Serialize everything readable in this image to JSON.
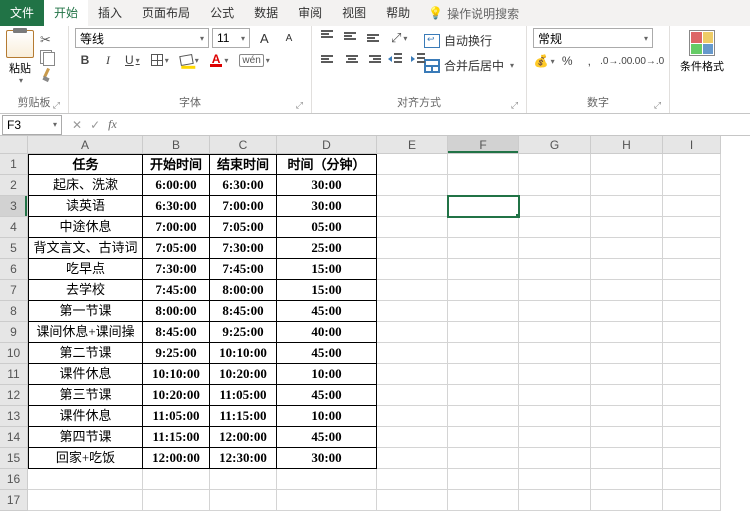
{
  "tabs": {
    "file": "文件",
    "home": "开始",
    "insert": "插入",
    "layout": "页面布局",
    "formulas": "公式",
    "data": "数据",
    "review": "审阅",
    "view": "视图",
    "help": "帮助",
    "tellme": "操作说明搜索"
  },
  "ribbon": {
    "clipboard": {
      "paste": "粘贴",
      "label": "剪贴板"
    },
    "font": {
      "name": "等线",
      "size": "11",
      "label": "字体",
      "wen": "wén"
    },
    "align": {
      "wrap": "自动换行",
      "merge": "合并后居中",
      "label": "对齐方式"
    },
    "number": {
      "format": "常规",
      "label": "数字"
    },
    "styles": {
      "cond": "条件格式"
    }
  },
  "namebox": "F3",
  "columns": [
    "A",
    "B",
    "C",
    "D",
    "E",
    "F",
    "G",
    "H",
    "I"
  ],
  "headers": {
    "task": "任务",
    "start": "开始时间",
    "end": "结束时间",
    "dur": "时间（分钟）"
  },
  "rows": [
    {
      "task": "起床、洗漱",
      "start": "6:00:00",
      "end": "6:30:00",
      "dur": "30:00"
    },
    {
      "task": "读英语",
      "start": "6:30:00",
      "end": "7:00:00",
      "dur": "30:00"
    },
    {
      "task": "中途休息",
      "start": "7:00:00",
      "end": "7:05:00",
      "dur": "05:00"
    },
    {
      "task": "背文言文、古诗词",
      "start": "7:05:00",
      "end": "7:30:00",
      "dur": "25:00"
    },
    {
      "task": "吃早点",
      "start": "7:30:00",
      "end": "7:45:00",
      "dur": "15:00"
    },
    {
      "task": "去学校",
      "start": "7:45:00",
      "end": "8:00:00",
      "dur": "15:00"
    },
    {
      "task": "第一节课",
      "start": "8:00:00",
      "end": "8:45:00",
      "dur": "45:00"
    },
    {
      "task": "课间休息+课间操",
      "start": "8:45:00",
      "end": "9:25:00",
      "dur": "40:00"
    },
    {
      "task": "第二节课",
      "start": "9:25:00",
      "end": "10:10:00",
      "dur": "45:00"
    },
    {
      "task": "课件休息",
      "start": "10:10:00",
      "end": "10:20:00",
      "dur": "10:00"
    },
    {
      "task": "第三节课",
      "start": "10:20:00",
      "end": "11:05:00",
      "dur": "45:00"
    },
    {
      "task": "课件休息",
      "start": "11:05:00",
      "end": "11:15:00",
      "dur": "10:00"
    },
    {
      "task": "第四节课",
      "start": "11:15:00",
      "end": "12:00:00",
      "dur": "45:00"
    },
    {
      "task": "回家+吃饭",
      "start": "12:00:00",
      "end": "12:30:00",
      "dur": "30:00"
    }
  ],
  "active": {
    "row": 3,
    "col": "F"
  }
}
